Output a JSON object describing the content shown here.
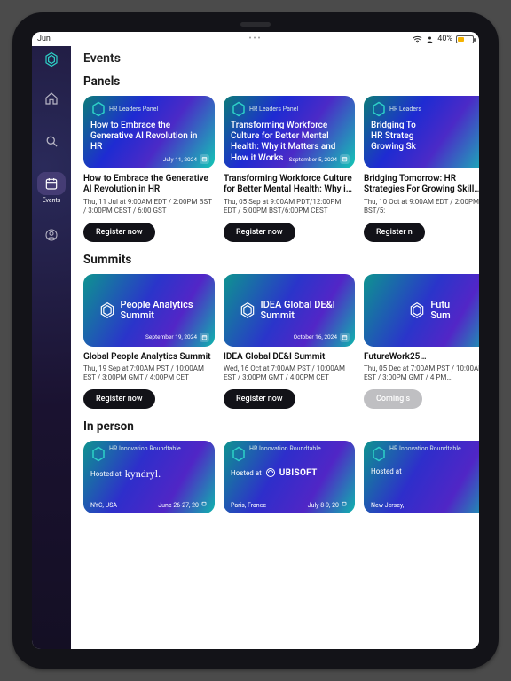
{
  "status": {
    "time": "Jun",
    "battery_pct": "40%"
  },
  "page": {
    "title": "Events"
  },
  "sidebar": {
    "items": [
      {
        "label": ""
      },
      {
        "label": ""
      },
      {
        "label": "Events"
      },
      {
        "label": ""
      }
    ]
  },
  "sections": {
    "panels": {
      "title": "Panels",
      "items": [
        {
          "badge": "HR Leaders Panel",
          "hero_title": "How to Embrace the Generative AI Revolution in HR",
          "hero_date": "July 11, 2024",
          "title": "How to Embrace the Generative AI Revolution in HR",
          "subtitle": "Thu, 11 Jul at 9:00AM EDT / 2:00PM BST / 3:00PM CEST / 6:00 GST",
          "cta": "Register now"
        },
        {
          "badge": "HR Leaders Panel",
          "hero_title": "Transforming Workforce Culture for Better Mental Health: Why it Matters and How it Works",
          "hero_date": "September 5, 2024",
          "title": "Transforming Workforce Culture for Better Mental Health: Why it M…",
          "subtitle": "Thu, 05 Sep at 9:00AM PDT/12:00PM EDT / 5:00PM BST/6:00PM CEST",
          "cta": "Register now"
        },
        {
          "badge": "HR Leaders",
          "hero_title": "Bridging To\nHR Strateg\nGrowing Sk",
          "hero_date": "",
          "title": "Bridging Tomorrow: HR Strategies For Growing Skill…",
          "subtitle": "Thu, 10 Oct at 9:00AM EDT / 2:00PM BST/5:",
          "cta": "Register n"
        }
      ]
    },
    "summits": {
      "title": "Summits",
      "items": [
        {
          "hero_text": "People Analytics Summit",
          "hero_date": "September 19, 2024",
          "title": "Global People Analytics Summit",
          "subtitle": "Thu, 19 Sep at 7:00AM PST / 10:00AM EST / 3:00PM GMT / 4:00PM CET",
          "cta": "Register now",
          "cta_disabled": false
        },
        {
          "hero_text": "IDEA Global DE&I Summit",
          "hero_date": "October 16, 2024",
          "title": "IDEA Global DE&I Summit",
          "subtitle": "Wed, 16 Oct at 7:00AM PST / 10:00AM EST / 3:00PM GMT / 4:00PM CET",
          "cta": "Register now",
          "cta_disabled": false
        },
        {
          "hero_text": "Futu\nSum",
          "hero_date": "",
          "title": "FutureWork25…",
          "subtitle": "Thu, 05 Dec at 7:00AM PST / 10:00AM EST / 3:00PM GMT / 4 PM…",
          "cta": "Coming s",
          "cta_disabled": true
        }
      ]
    },
    "inperson": {
      "title": "In person",
      "items": [
        {
          "badge": "HR Innovation Roundtable",
          "hosted": "Hosted at",
          "brand": "kyndryl.",
          "city": "NYC, USA",
          "date": "June 26-27, 20"
        },
        {
          "badge": "HR Innovation Roundtable",
          "hosted": "Hosted at",
          "brand": "UBISOFT",
          "city": "Paris, France",
          "date": "July 8-9, 20"
        },
        {
          "badge": "HR Innovation Roundtable",
          "hosted": "Hosted at",
          "brand": "",
          "city": "New Jersey, ",
          "date": ""
        }
      ]
    }
  }
}
